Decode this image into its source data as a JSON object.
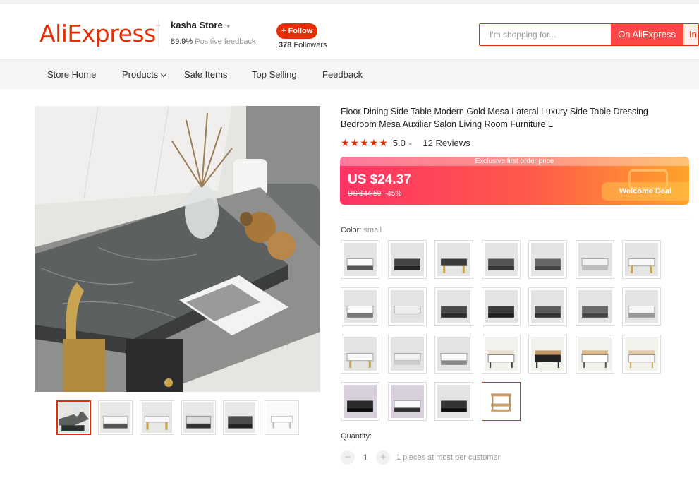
{
  "header": {
    "logo": "AliExpress",
    "store_name": "kasha Store",
    "feedback_value": "89.9%",
    "feedback_label": "Positive feedback",
    "follow_label": "+ Follow",
    "followers_count": "378",
    "followers_label": "Followers",
    "search_placeholder": "I'm shopping for...",
    "search_aliexpress": "On AliExpress",
    "search_store": "In"
  },
  "nav": {
    "store_home": "Store Home",
    "products": "Products",
    "sale_items": "Sale Items",
    "top_selling": "Top Selling",
    "feedback": "Feedback"
  },
  "product": {
    "title": "Floor Dining Side Table Modern Gold Mesa Lateral Luxury Side Table Dressing Bedroom Mesa Auxiliar Salon Living Room Furniture L",
    "stars": "★★★★★",
    "rating": "5.0",
    "reviews": "12 Reviews",
    "price_banner": "Exclusive first order price",
    "price": "US $24.37",
    "old_price": "US $44.50",
    "discount": "-45%",
    "welcome_deal": "Welcome Deal",
    "color_label": "Color:",
    "color_value": "small",
    "quantity_label": "Quantity:",
    "quantity_value": "1",
    "quantity_note": "1 pieces at most per customer",
    "minus": "−",
    "plus": "+"
  },
  "colors": {
    "accent": "#e62e04",
    "price_start": "#ff3366",
    "price_end": "#ffa32a"
  }
}
